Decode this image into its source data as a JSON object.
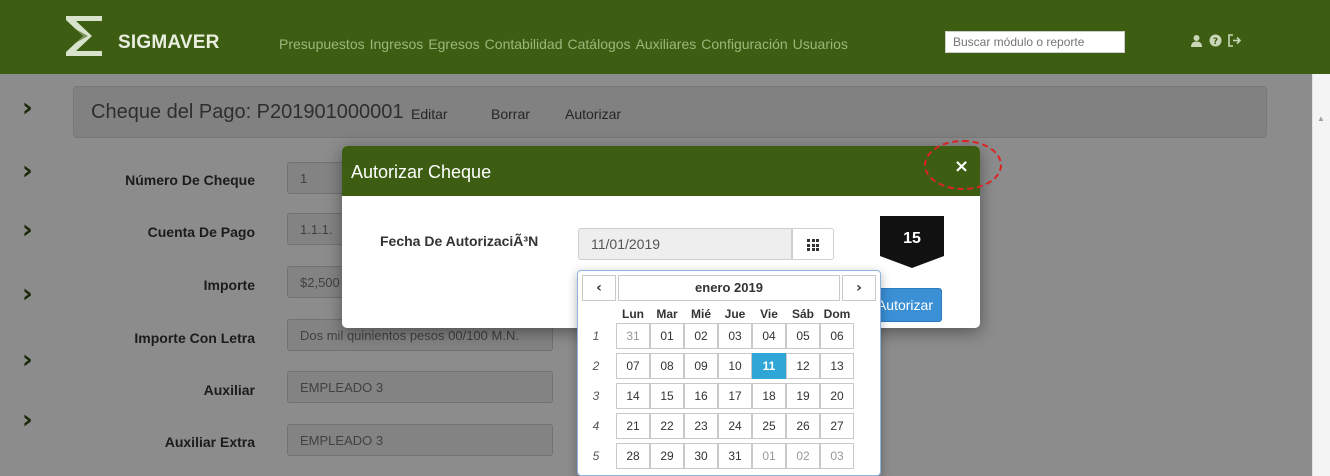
{
  "brand": {
    "name": "SIGMAVER"
  },
  "nav": {
    "menu": [
      "Presupuestos",
      "Ingresos",
      "Egresos",
      "Contabilidad",
      "Catálogos",
      "Auxiliares",
      "Configuración",
      "Usuarios"
    ],
    "search_placeholder": "Buscar módulo o reporte",
    "icons": [
      "user-icon",
      "help-icon",
      "logout-icon"
    ]
  },
  "header": {
    "title": "Cheque del Pago: P201901000001",
    "actions": [
      "Editar",
      "Borrar",
      "Autorizar"
    ]
  },
  "form": {
    "rows": [
      {
        "label": "Número De Cheque",
        "value": "1"
      },
      {
        "label": "Cuenta De Pago",
        "value": "1.1.1."
      },
      {
        "label": "Importe",
        "value": "$2,500"
      },
      {
        "label": "Importe Con Letra",
        "value": "Dos mil quinientos pesos 00/100 M.N."
      },
      {
        "label": "Auxiliar",
        "value": "EMPLEADO 3"
      },
      {
        "label": "Auxiliar Extra",
        "value": "EMPLEADO 3"
      }
    ]
  },
  "modal": {
    "title": "Autorizar Cheque",
    "close_label": "×",
    "field_label": "Fecha De AutorizaciÃ³N",
    "date_value": "11/01/2019",
    "submit_label": "Autorizar"
  },
  "callout": {
    "number": "15"
  },
  "datepicker": {
    "month_label": "enero 2019",
    "prev_label": "‹",
    "next_label": "›",
    "weekdays": [
      "Lun",
      "Mar",
      "Mié",
      "Jue",
      "Vie",
      "Sáb",
      "Dom"
    ],
    "weeks": [
      {
        "num": "1",
        "days": [
          "31",
          "01",
          "02",
          "03",
          "04",
          "05",
          "06"
        ]
      },
      {
        "num": "2",
        "days": [
          "07",
          "08",
          "09",
          "10",
          "11",
          "12",
          "13"
        ]
      },
      {
        "num": "3",
        "days": [
          "14",
          "15",
          "16",
          "17",
          "18",
          "19",
          "20"
        ]
      },
      {
        "num": "4",
        "days": [
          "21",
          "22",
          "23",
          "24",
          "25",
          "26",
          "27"
        ]
      },
      {
        "num": "5",
        "days": [
          "28",
          "29",
          "30",
          "31",
          "01",
          "02",
          "03"
        ]
      }
    ],
    "selected": "11"
  },
  "colors": {
    "navbar": "#3d5e12",
    "accent_blue": "#3a8fd5",
    "selected_day": "#2fa6d6",
    "callout_badge": "#111111",
    "highlight_red": "#dd2222"
  }
}
